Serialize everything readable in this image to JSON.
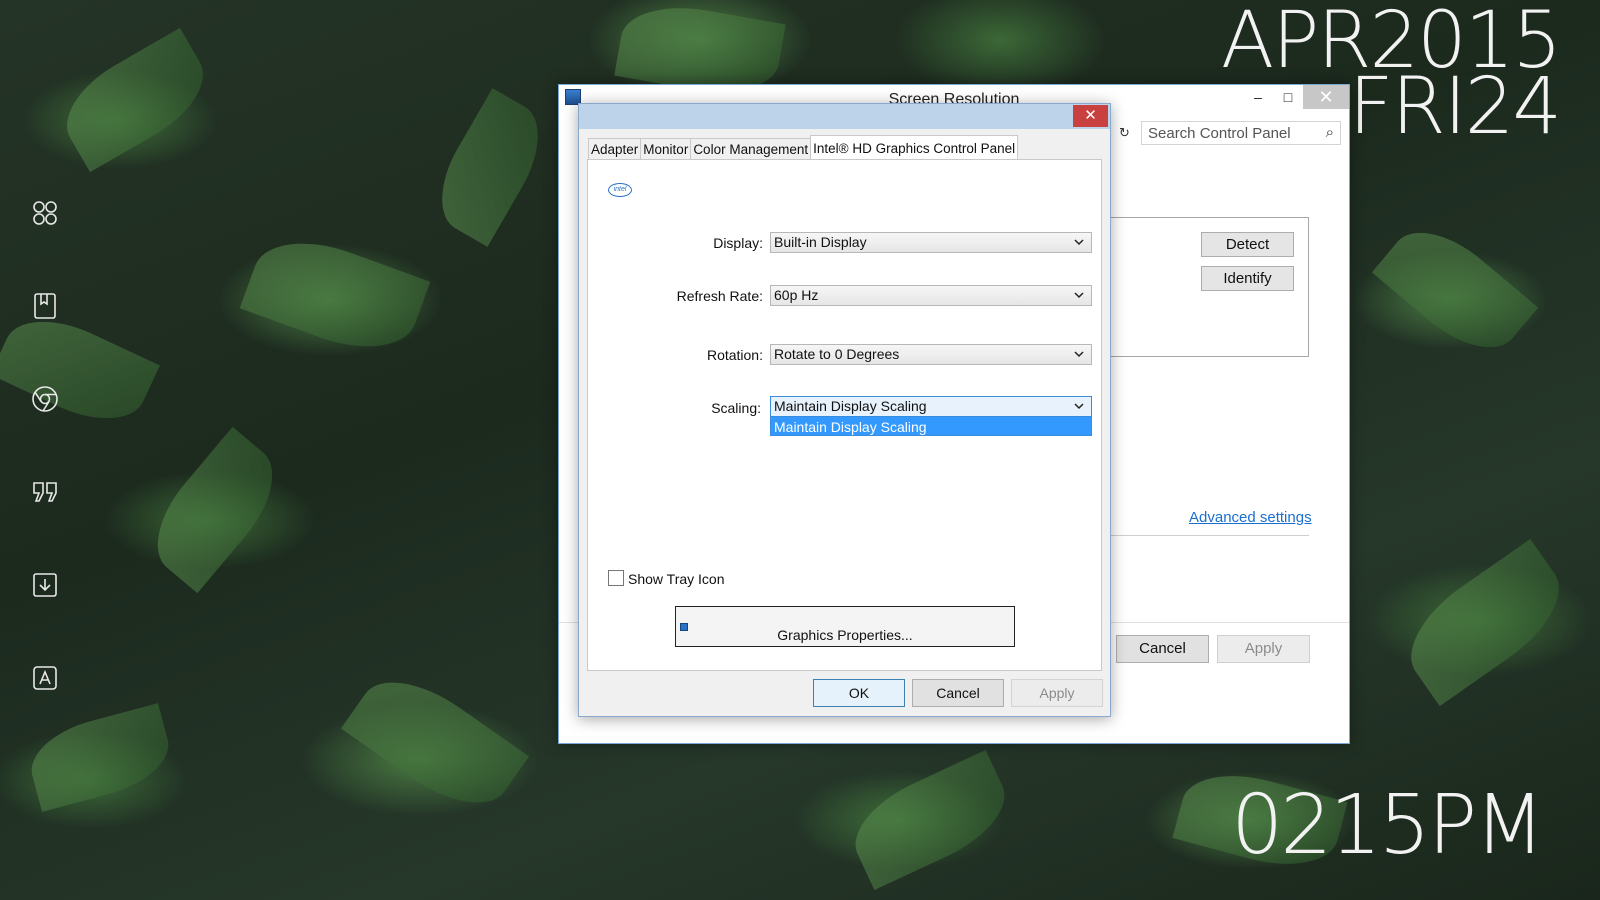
{
  "desktop": {
    "clock_date": "APR2015\nFRI24",
    "clock_time": "0215PM",
    "dock_icons": [
      "apps-grid-icon",
      "book-icon",
      "chrome-icon",
      "quote-icon",
      "download-icon",
      "app-store-icon"
    ]
  },
  "back_window": {
    "title": "Screen Resolution",
    "search_placeholder": "Search Control Panel",
    "detect_label": "Detect",
    "identify_label": "Identify",
    "advanced_link": "Advanced settings",
    "cancel_label": "Cancel",
    "apply_label": "Apply",
    "min_glyph": "–",
    "max_glyph": "□",
    "close_glyph": "✕"
  },
  "dialog": {
    "close_glyph": "✕",
    "tabs": [
      "Adapter",
      "Monitor",
      "Color Management",
      "Intel® HD Graphics Control Panel"
    ],
    "active_tab": 3,
    "logo_text": "intel",
    "fields": {
      "display": {
        "label": "Display:",
        "value": "Built-in Display"
      },
      "refresh_rate": {
        "label": "Refresh Rate:",
        "value": "60p Hz"
      },
      "rotation": {
        "label": "Rotation:",
        "value": "Rotate to 0 Degrees"
      },
      "scaling": {
        "label": "Scaling:",
        "value": "Maintain Display Scaling",
        "dropdown_open_option": "Maintain Display Scaling"
      }
    },
    "show_tray_icon": {
      "label": "Show Tray Icon",
      "checked": false
    },
    "graphics_properties_label": "Graphics Properties...",
    "ok_label": "OK",
    "cancel_label": "Cancel",
    "apply_label": "Apply"
  },
  "colors": {
    "dialog_title_bg": "#bcd3ea",
    "close_red": "#c94040",
    "selection_blue": "#3399ff",
    "link_blue": "#1a6fd1"
  }
}
